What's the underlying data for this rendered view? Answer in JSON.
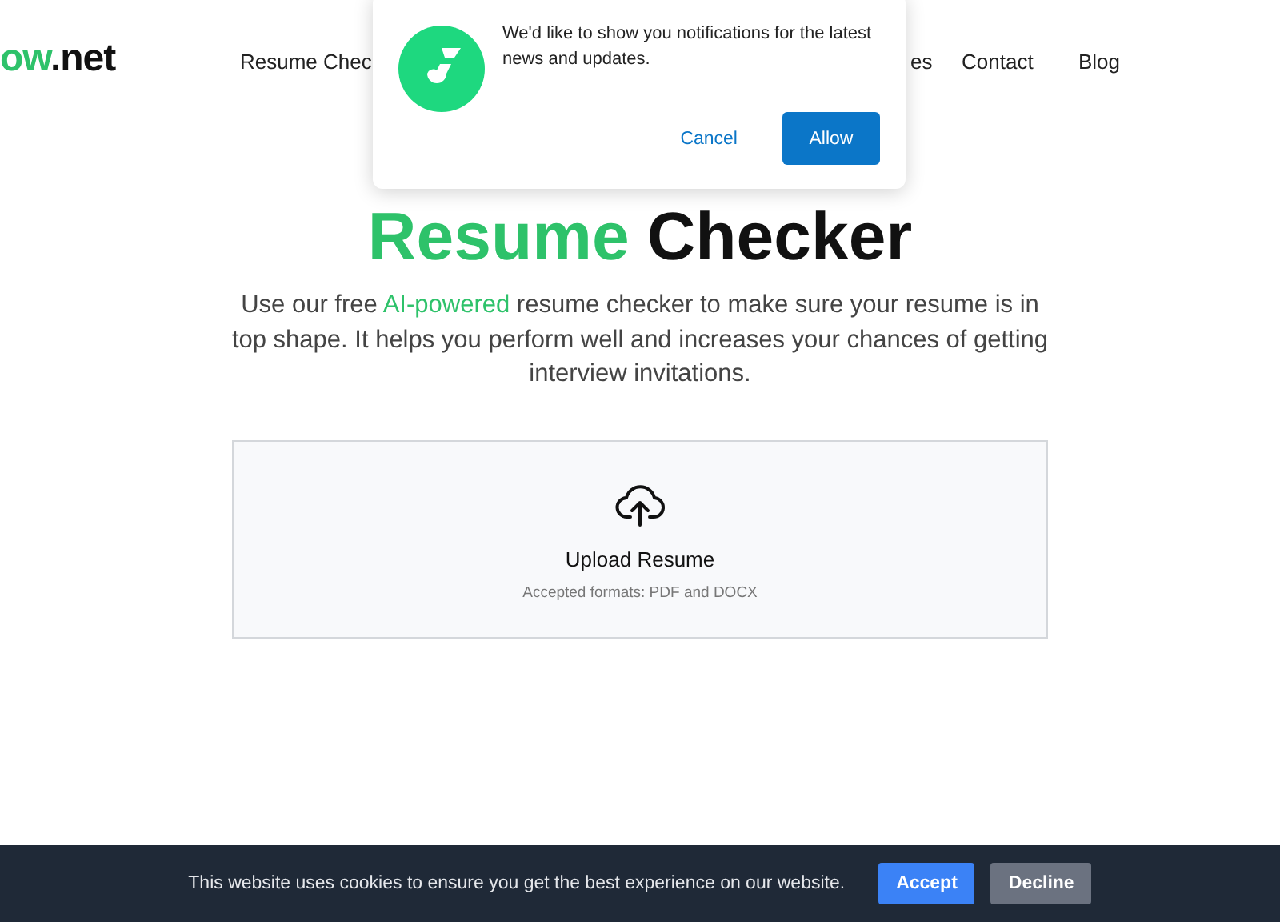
{
  "header": {
    "logo": {
      "accent": "ow",
      "rest": ".net"
    },
    "nav": [
      "Resume Chec",
      "es",
      "Contact",
      "Blog"
    ]
  },
  "notification_prompt": {
    "message": "We'd like to show you notifications for the latest news and updates.",
    "buttons": [
      {
        "label": "Cancel",
        "kind": "link"
      },
      {
        "label": "Allow",
        "kind": "primary"
      }
    ]
  },
  "hero": {
    "heading": [
      {
        "text": "Resume",
        "accent": true
      },
      {
        "text": "Checker",
        "accent": false
      }
    ],
    "description": [
      {
        "text": "Use our free ",
        "accent": false
      },
      {
        "text": "AI-powered",
        "accent": true
      },
      {
        "text": " resume checker to make sure your resume is in top shape. It helps you perform well and increases your chances of getting interview invitations.",
        "accent": false
      }
    ]
  },
  "upload": {
    "label": "Upload Resume",
    "hint": "Accepted formats: PDF and DOCX"
  },
  "cookie_bar": {
    "message": "This website uses cookies to ensure you get the best experience on our website.",
    "buttons": [
      {
        "label": "Accept",
        "kind": "primary"
      },
      {
        "label": "Decline",
        "kind": "secondary"
      }
    ]
  }
}
